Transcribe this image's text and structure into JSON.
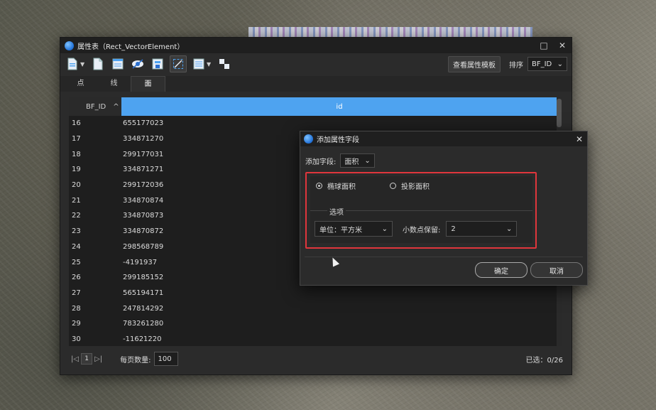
{
  "window": {
    "title": "属性表（Rect_VectorElement）",
    "controls": [
      "□",
      "✕"
    ]
  },
  "toolbar": {
    "template_button": "查看属性模板",
    "sort_label": "排序",
    "sort_value": "BF_ID"
  },
  "tabs": [
    {
      "label": "点",
      "active": false
    },
    {
      "label": "线",
      "active": false
    },
    {
      "label": "面",
      "active": true
    }
  ],
  "grid": {
    "columns": [
      "BF_ID",
      "id"
    ],
    "sort_indicator": "^",
    "rows": [
      {
        "bf_id": "16",
        "id": "655177023"
      },
      {
        "bf_id": "17",
        "id": "334871270"
      },
      {
        "bf_id": "18",
        "id": "299177031"
      },
      {
        "bf_id": "19",
        "id": "334871271"
      },
      {
        "bf_id": "20",
        "id": "299172036"
      },
      {
        "bf_id": "21",
        "id": "334870874"
      },
      {
        "bf_id": "22",
        "id": "334870873"
      },
      {
        "bf_id": "23",
        "id": "334870872"
      },
      {
        "bf_id": "24",
        "id": "298568789"
      },
      {
        "bf_id": "25",
        "id": "-4191937"
      },
      {
        "bf_id": "26",
        "id": "299185152"
      },
      {
        "bf_id": "27",
        "id": "565194171"
      },
      {
        "bf_id": "28",
        "id": "247814292"
      },
      {
        "bf_id": "29",
        "id": "783261280"
      },
      {
        "bf_id": "30",
        "id": "-11621220"
      }
    ]
  },
  "footer": {
    "page": "1",
    "per_page_label": "每页数量:",
    "per_page_value": "100",
    "selected": "已选：0/26"
  },
  "dialog": {
    "title": "添加属性字段",
    "add_field_label": "添加字段:",
    "add_field_value": "面积",
    "radio_ellipsoid": "椭球面积",
    "radio_projected": "投影面积",
    "options_title": "选项",
    "unit_value": "单位：平方米",
    "decimal_label": "小数点保留:",
    "decimal_value": "2",
    "ok_button": "确定",
    "cancel_button": "取消"
  }
}
